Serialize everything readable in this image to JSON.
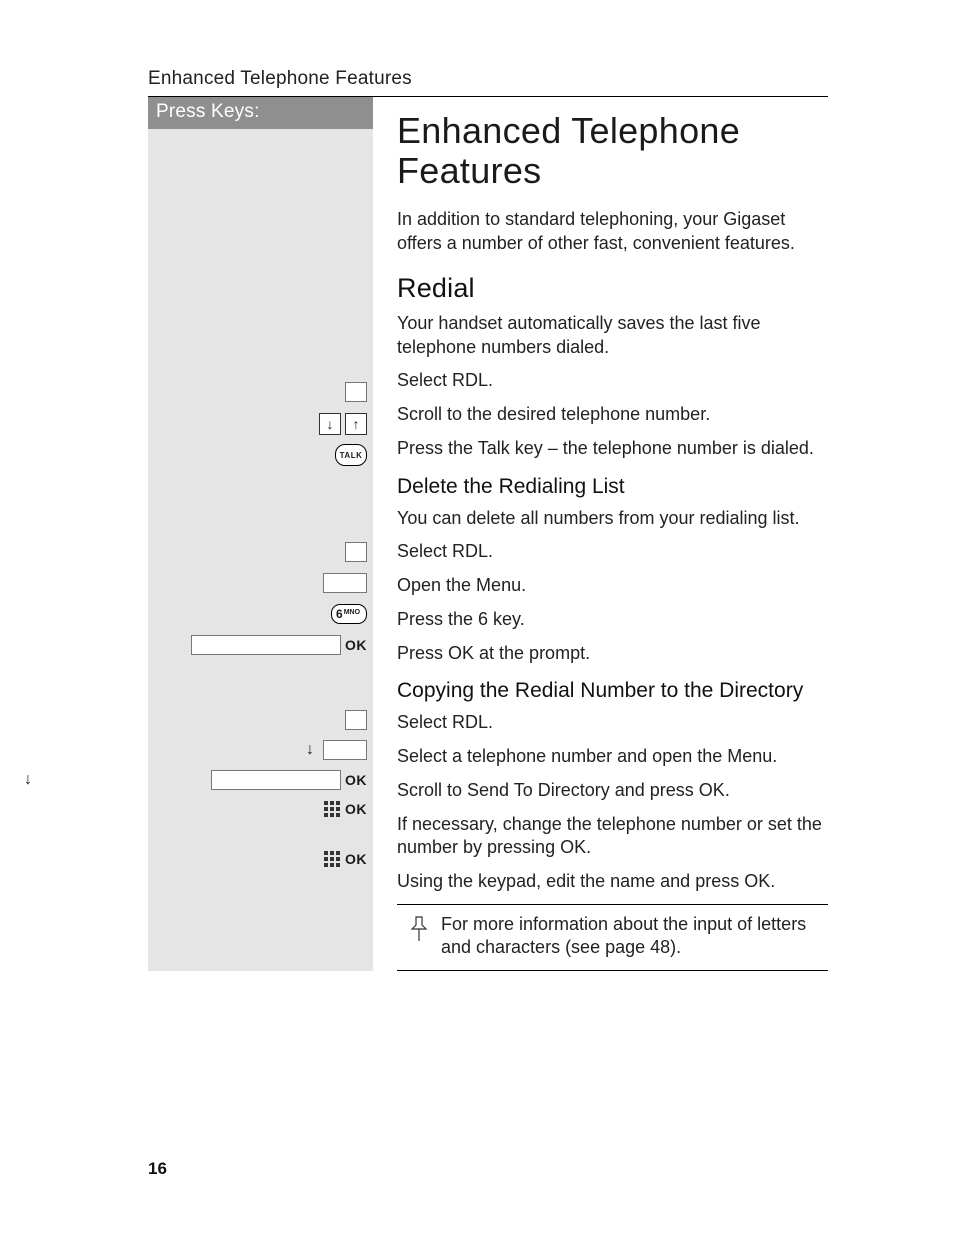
{
  "page_number": "16",
  "running_head": "Enhanced Telephone Features",
  "press_keys_header": "Press Keys:",
  "title": "Enhanced Telephone Features",
  "intro": "In addition to standard telephoning, your Gigaset offers a number of other fast, convenient features.",
  "sections": {
    "redial": {
      "heading": "Redial",
      "intro": "Your handset automatically saves the last five telephone numbers dialed.",
      "steps": [
        "Select RDL.",
        "Scroll to the desired telephone number.",
        "Press the Talk key – the telephone number is dialed."
      ]
    },
    "delete": {
      "heading": "Delete the Redialing List",
      "intro": "You can delete all numbers from your redialing list.",
      "steps": [
        "Select RDL.",
        "Open the Menu.",
        "Press the 6 key.",
        "Press OK at the prompt."
      ]
    },
    "copy": {
      "heading": "Copying the Redial Number to the Directory",
      "steps": [
        "Select RDL.",
        "Select a telephone number and open the Menu.",
        "Scroll to Send To Directory and press OK.",
        "If necessary, change the telephone number or set the number by pressing OK.",
        "Using the keypad, edit the name and press OK."
      ]
    }
  },
  "note": "For more information about the input of letters and characters (see page 48).",
  "key_labels": {
    "talk": "TALK",
    "ok": "OK",
    "six": "6",
    "six_letters": "MNO"
  }
}
